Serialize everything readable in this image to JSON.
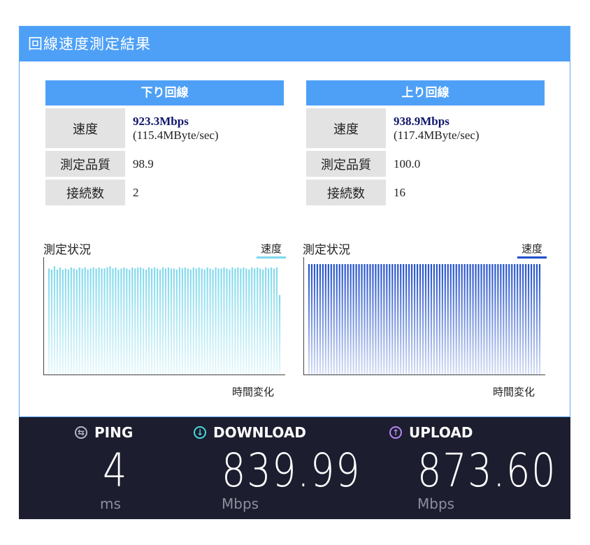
{
  "panel": {
    "title": "回線速度測定結果"
  },
  "download": {
    "header": "下り回線",
    "speed_label": "速度",
    "speed_value": "923.3Mbps",
    "speed_sub": "(115.4MByte/sec)",
    "quality_label": "測定品質",
    "quality_value": "98.9",
    "conn_label": "接続数",
    "conn_value": "2"
  },
  "upload": {
    "header": "上り回線",
    "speed_label": "速度",
    "speed_value": "938.9Mbps",
    "speed_sub": "(117.4MByte/sec)",
    "quality_label": "測定品質",
    "quality_value": "100.0",
    "conn_label": "接続数",
    "conn_value": "16"
  },
  "graphs": {
    "title": "測定状況",
    "legend": "速度",
    "xlabel": "時間変化"
  },
  "chart_data": [
    {
      "type": "bar",
      "series": [
        {
          "name": "速度",
          "color": "#7fd8ec",
          "values": [
            96,
            95,
            98,
            95,
            97,
            95,
            96,
            95,
            97,
            96,
            95,
            97,
            96,
            97,
            95,
            96,
            97,
            96,
            97,
            96,
            96,
            97,
            98,
            96,
            97,
            95,
            96,
            97,
            96,
            95,
            97,
            96,
            97,
            97,
            96,
            95,
            97,
            96,
            97,
            96,
            95,
            97,
            96,
            97,
            96,
            96,
            95,
            97,
            96,
            97,
            96,
            95,
            97,
            96,
            97,
            96,
            95,
            97,
            96,
            95,
            97,
            96,
            96,
            97,
            96,
            95,
            97,
            96,
            97,
            96,
            97,
            96,
            95,
            97,
            96,
            97,
            96,
            95,
            97,
            96,
            97,
            96,
            97,
            72
          ]
        }
      ],
      "ylim": [
        0,
        100
      ]
    },
    {
      "type": "bar",
      "series": [
        {
          "name": "速度",
          "color": "#1f4fc9",
          "values": [
            100,
            100,
            100,
            100,
            100,
            100,
            100,
            100,
            100,
            100,
            100,
            100,
            100,
            100,
            100,
            100,
            100,
            100,
            100,
            100,
            100,
            100,
            100,
            100,
            100,
            100,
            100,
            100,
            100,
            100,
            100,
            100,
            100,
            100,
            100,
            100,
            100,
            100,
            100,
            100,
            100,
            100,
            100,
            100,
            100,
            100,
            100,
            100,
            100,
            100,
            100,
            100,
            100,
            100,
            100,
            100,
            100,
            100,
            100,
            100,
            100,
            100,
            100,
            100,
            100,
            100,
            100,
            100,
            100,
            100,
            100,
            100,
            100,
            100,
            100,
            100,
            100,
            100,
            100,
            100,
            100,
            100,
            100,
            100
          ]
        }
      ],
      "ylim": [
        0,
        100
      ]
    }
  ],
  "bottom": {
    "ping": {
      "label": "PING",
      "value": "4",
      "unit": "ms",
      "icon": "ping-icon",
      "color": "#b4b6c4"
    },
    "download": {
      "label": "DOWNLOAD",
      "value": "839.99",
      "unit": "Mbps",
      "icon": "download-arrow-icon",
      "color": "#4ad8d8"
    },
    "upload": {
      "label": "UPLOAD",
      "value": "873.60",
      "unit": "Mbps",
      "icon": "upload-arrow-icon",
      "color": "#b388f5"
    }
  }
}
